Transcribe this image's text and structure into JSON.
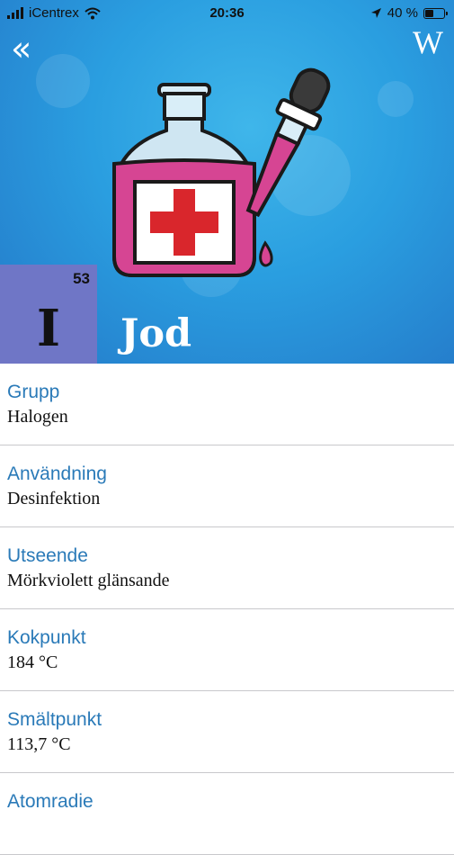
{
  "status_bar": {
    "carrier": "iCentrex",
    "time": "20:36",
    "battery": "40 %"
  },
  "header": {
    "back_icon": "double-chevron-left-icon",
    "wiki_label": "W"
  },
  "element": {
    "atomic_number": "53",
    "symbol": "I",
    "name": "Jod",
    "tile_color": "#6f76c6"
  },
  "properties": [
    {
      "label": "Grupp",
      "value": "Halogen"
    },
    {
      "label": "Användning",
      "value": "Desinfektion"
    },
    {
      "label": "Utseende",
      "value": "Mörkviolett glänsande"
    },
    {
      "label": "Kokpunkt",
      "value": "184 °C"
    },
    {
      "label": "Smältpunkt",
      "value": "113,7 °C"
    },
    {
      "label": "Atomradie",
      "value": ""
    }
  ],
  "colors": {
    "accent_label": "#2a7ab8",
    "hero_blue": "#2a9ee0",
    "liquid": "#d64593",
    "cross": "#d9262c"
  }
}
